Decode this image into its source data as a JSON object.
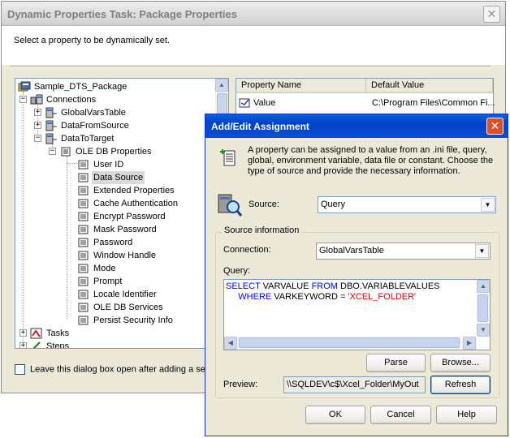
{
  "outer": {
    "title": "Dynamic Properties Task: Package Properties",
    "close": "✕",
    "instruction": "Select a property to be dynamically set.",
    "leave_open_label": "Leave this dialog box open after adding a setti"
  },
  "tree": {
    "items": [
      {
        "label": "Sample_DTS_Package",
        "icon": "package-icon"
      },
      {
        "label": "Connections",
        "icon": "connections-icon",
        "toggle": "−"
      },
      {
        "label": "GlobalVarsTable",
        "icon": "connection-icon",
        "toggle": "+"
      },
      {
        "label": "DataFromSource",
        "icon": "connection-icon",
        "toggle": "+"
      },
      {
        "label": "DataToTarget",
        "icon": "connection-icon",
        "toggle": "−"
      },
      {
        "label": "OLE DB Properties",
        "icon": "properties-icon",
        "toggle": "−"
      },
      {
        "label": "User ID",
        "icon": "property-icon"
      },
      {
        "label": "Data Source",
        "icon": "property-icon"
      },
      {
        "label": "Extended Properties",
        "icon": "property-icon"
      },
      {
        "label": "Cache Authentication",
        "icon": "property-icon"
      },
      {
        "label": "Encrypt Password",
        "icon": "property-icon"
      },
      {
        "label": "Mask Password",
        "icon": "property-icon"
      },
      {
        "label": "Password",
        "icon": "property-icon"
      },
      {
        "label": "Window Handle",
        "icon": "property-icon"
      },
      {
        "label": "Mode",
        "icon": "property-icon"
      },
      {
        "label": "Prompt",
        "icon": "property-icon"
      },
      {
        "label": "Locale Identifier",
        "icon": "property-icon"
      },
      {
        "label": "OLE DB Services",
        "icon": "property-icon"
      },
      {
        "label": "Persist Security Info",
        "icon": "property-icon"
      },
      {
        "label": "Tasks",
        "icon": "tasks-icon",
        "toggle": "+"
      },
      {
        "label": "Steps",
        "icon": "steps-icon",
        "toggle": "+"
      }
    ],
    "selected": "Data Source"
  },
  "properties": {
    "columns": [
      "Property Name",
      "Default Value"
    ],
    "rows": [
      {
        "name": "Value",
        "default": "C:\\Program Files\\Common Fi..."
      }
    ]
  },
  "inner": {
    "title": "Add/Edit Assignment",
    "close": "✕",
    "info": "A property can be assigned to a value from an .ini file, query, global, environment variable, data file or constant.  Choose the type of source and provide the necessary information.",
    "source_label": "Source:",
    "source_value": "Query",
    "source_info_legend": "Source information",
    "connection_label": "Connection:",
    "connection_value": "GlobalVarsTable",
    "query_label": "Query:",
    "query": {
      "kw_select": "SELECT",
      "t1": " VARVALUE ",
      "kw_from": "FROM",
      "t2": " DBO.VARIABLEVALUES",
      "kw_where": "WHERE",
      "t3": " VARKEYWORD = ",
      "str": "'XCEL_FOLDER'"
    },
    "parse_button": "Parse",
    "browse_button": "Browse...",
    "preview_label": "Preview:",
    "preview_value": "\\\\SQLDEV\\c$\\Xcel_Folder\\MyOut",
    "refresh_button": "Refresh",
    "ok_button": "OK",
    "cancel_button": "Cancel",
    "help_button": "Help"
  },
  "colors": {
    "xp_title_blue": "#0041c8",
    "close_red": "#d9502a",
    "keyword_blue": "#0000ff",
    "string_red": "#e00000"
  }
}
